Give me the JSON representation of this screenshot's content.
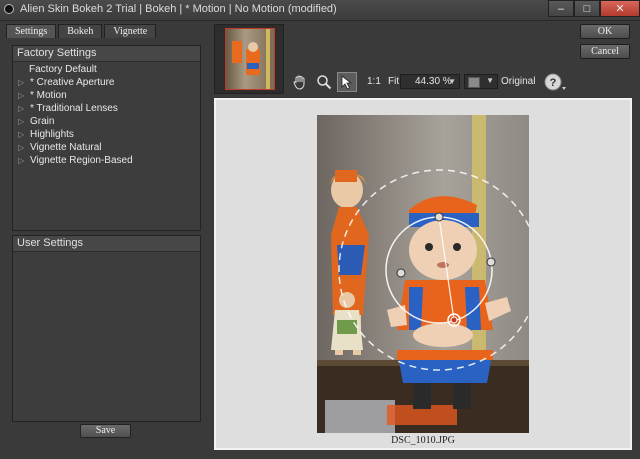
{
  "window": {
    "title": "Alien Skin Bokeh 2 Trial | Bokeh | * Motion | No Motion (modified)",
    "minimize_glyph": "–",
    "maximize_glyph": "□",
    "close_glyph": "✕"
  },
  "tabs": [
    {
      "label": "Settings",
      "active": true
    },
    {
      "label": "Bokeh",
      "active": false
    },
    {
      "label": "Vignette",
      "active": false
    }
  ],
  "factory": {
    "header": "Factory Settings",
    "items": [
      {
        "label": "Factory Default",
        "expandable": false
      },
      {
        "label": "* Creative Aperture",
        "expandable": true
      },
      {
        "label": "* Motion",
        "expandable": true
      },
      {
        "label": "* Traditional Lenses",
        "expandable": true
      },
      {
        "label": "Grain",
        "expandable": true
      },
      {
        "label": "Highlights",
        "expandable": true
      },
      {
        "label": "Vignette Natural",
        "expandable": true
      },
      {
        "label": "Vignette Region-Based",
        "expandable": true
      }
    ]
  },
  "user": {
    "header": "User Settings"
  },
  "buttons": {
    "save": "Save",
    "ok": "OK",
    "cancel": "Cancel"
  },
  "toolbar": {
    "zoom_1to1": "1:1",
    "fit": "Fit",
    "zoom_value": "44.30 %",
    "original": "Original",
    "help_glyph": "?"
  },
  "preview": {
    "filename": "DSC_1010.JPG"
  },
  "colors": {
    "accent_red": "#c43a2a",
    "doll_orange": "#e86a1f",
    "doll_blue": "#2a62c4"
  }
}
